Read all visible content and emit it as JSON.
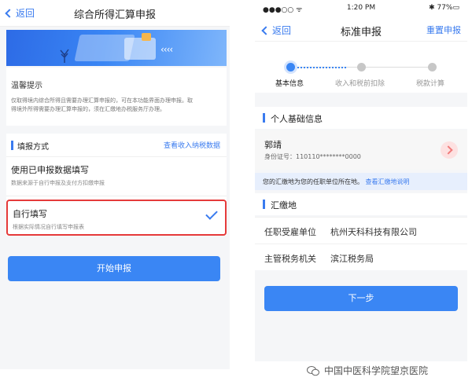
{
  "left": {
    "nav": {
      "back_label": "返回",
      "title": "综合所得汇算申报"
    },
    "tips": {
      "title": "温馨提示",
      "line1": "仅取得境内综合所得且需要办理汇算申报的，可在本功能界面办理申报。取",
      "line2": "得境外所得需要办理汇算申报的，须在汇缴地办税服务厅办理。"
    },
    "method": {
      "title": "填报方式",
      "link": "查看收入纳税数据",
      "options": [
        {
          "title": "使用已申报数据填写",
          "desc": "数据来源于自行申报及支付方扣缴申报"
        },
        {
          "title": "自行填写",
          "desc": "根据实际情况自行填写申报表"
        }
      ]
    },
    "start_button": "开始申报",
    "banner_arrows": "‹‹‹‹"
  },
  "right": {
    "status": {
      "left": "●●●○○ ᯤ",
      "time": "1:20 PM",
      "right": "✱ 77%▭"
    },
    "nav": {
      "back_label": "返回",
      "title": "标准申报",
      "reset": "重置申报"
    },
    "steps": [
      {
        "label": "基本信息",
        "active": true
      },
      {
        "label": "收入和税前扣除",
        "active": false
      },
      {
        "label": "税款计算",
        "active": false
      }
    ],
    "personal": {
      "title": "个人基础信息",
      "name": "郭靖",
      "id_label": "身份证号：",
      "id_value": "110110********0000"
    },
    "notice": {
      "text": "您的汇缴地为您的任职单位所在地。",
      "link": "查看汇缴地说明"
    },
    "remit": {
      "title": "汇缴地",
      "rows": [
        {
          "key": "任职受雇单位",
          "value": "杭州天科科技有限公司"
        },
        {
          "key": "主管税务机关",
          "value": "滨江税务局"
        }
      ]
    },
    "next_button": "下一步"
  },
  "watermark": "中国中医科学院望京医院",
  "colors": {
    "accent": "#3a86f4",
    "highlight_border": "#e53a3a"
  }
}
